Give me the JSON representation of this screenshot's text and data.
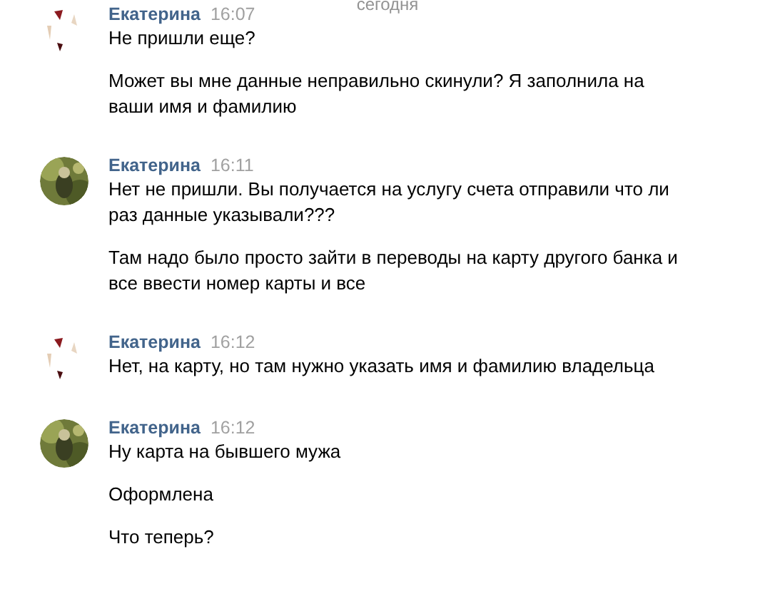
{
  "day_divider": "сегодня",
  "messages": [
    {
      "author": "Екатерина",
      "time": "16:07",
      "paragraphs": [
        "Не пришли еще?",
        "Может вы мне данные неправильно скинули? Я заполнила на ваши имя и фамилию"
      ]
    },
    {
      "author": "Екатерина",
      "time": "16:11",
      "paragraphs": [
        "Нет не пришли. Вы получается на услугу счета отправили что ли раз данные указывали???",
        "Там надо было просто зайти в переводы на карту другого банка и все ввести номер карты и все"
      ]
    },
    {
      "author": "Екатерина",
      "time": "16:12",
      "paragraphs": [
        "Нет, на карту, но там нужно указать имя и фамилию владельца"
      ]
    },
    {
      "author": "Екатерина",
      "time": "16:12",
      "paragraphs": [
        "Ну карта на бывшего мужа",
        "Оформлена",
        "Что теперь?"
      ]
    }
  ]
}
